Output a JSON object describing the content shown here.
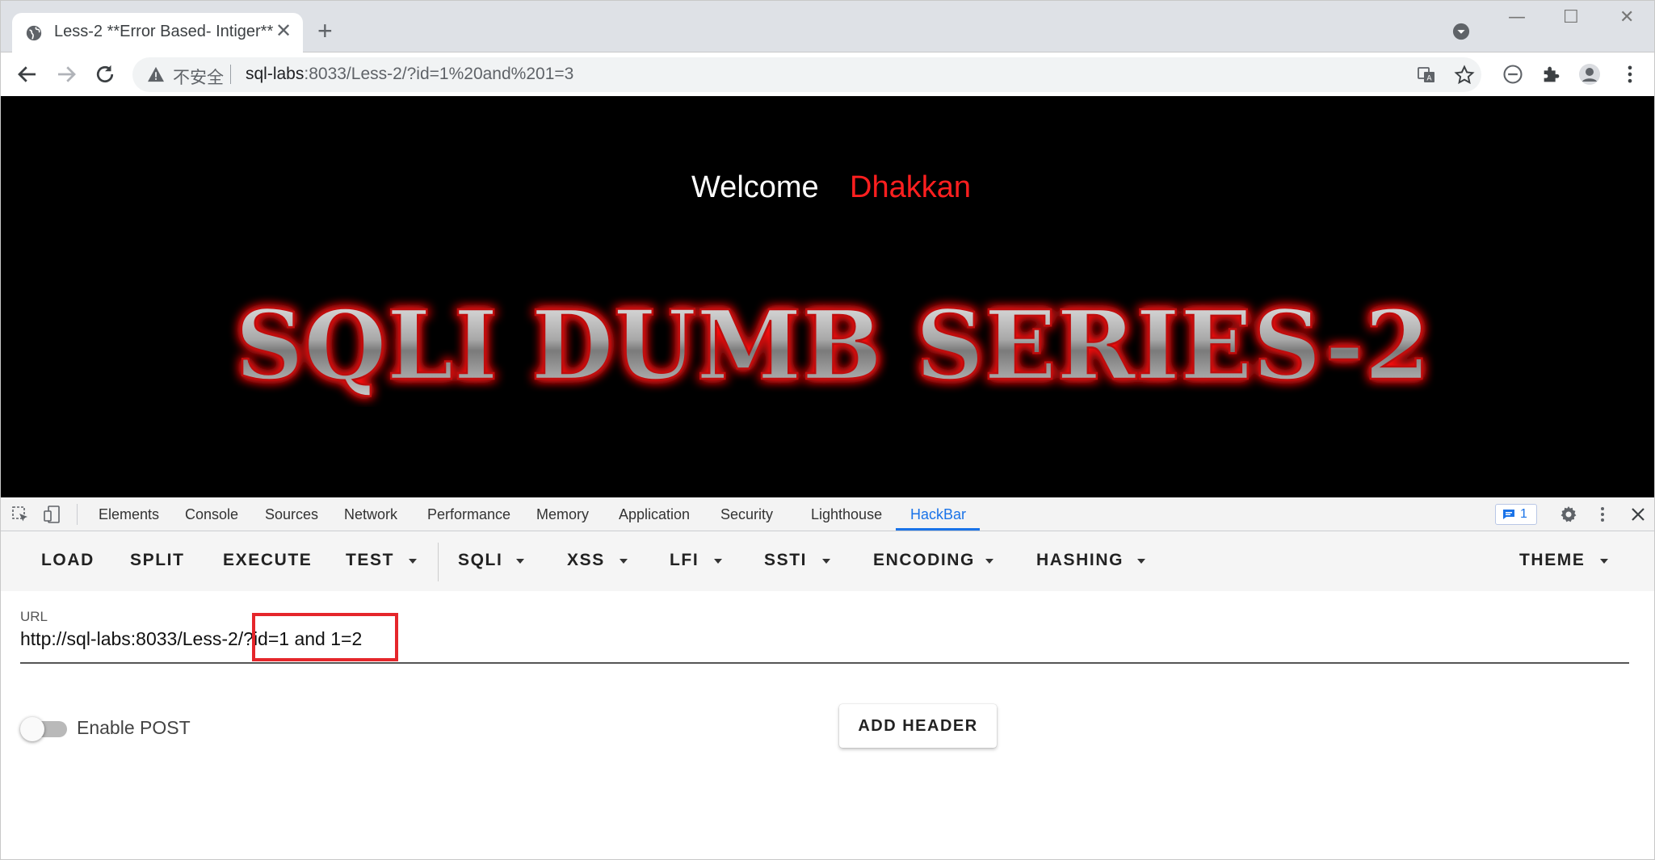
{
  "browser": {
    "tab_title": "Less-2 **Error Based- Intiger**",
    "insecure_label": "不安全",
    "url_host": "sql-labs",
    "url_rest": ":8033/Less-2/?id=1%20and%201=3"
  },
  "page": {
    "welcome": "Welcome",
    "name": "Dhakkan",
    "banner": "SQLI DUMB SERIES-2"
  },
  "devtools": {
    "tabs": [
      "Elements",
      "Console",
      "Sources",
      "Network",
      "Performance",
      "Memory",
      "Application",
      "Security",
      "Lighthouse",
      "HackBar"
    ],
    "active_tab": "HackBar",
    "message_count": "1"
  },
  "hackbar": {
    "menu": {
      "load": "LOAD",
      "split": "SPLIT",
      "execute": "EXECUTE",
      "test": "TEST",
      "sqli": "SQLI",
      "xss": "XSS",
      "lfi": "LFI",
      "ssti": "SSTI",
      "encoding": "ENCODING",
      "hashing": "HASHING",
      "theme": "THEME"
    },
    "url_label": "URL",
    "url_value": "http://sql-labs:8033/Less-2/?id=1 and 1=2",
    "enable_post_label": "Enable POST",
    "enable_post": false,
    "add_header_label": "ADD HEADER"
  },
  "colors": {
    "accent": "#1a73e8",
    "welcome_name": "#ff1f1f",
    "highlight": "#e5262b"
  }
}
